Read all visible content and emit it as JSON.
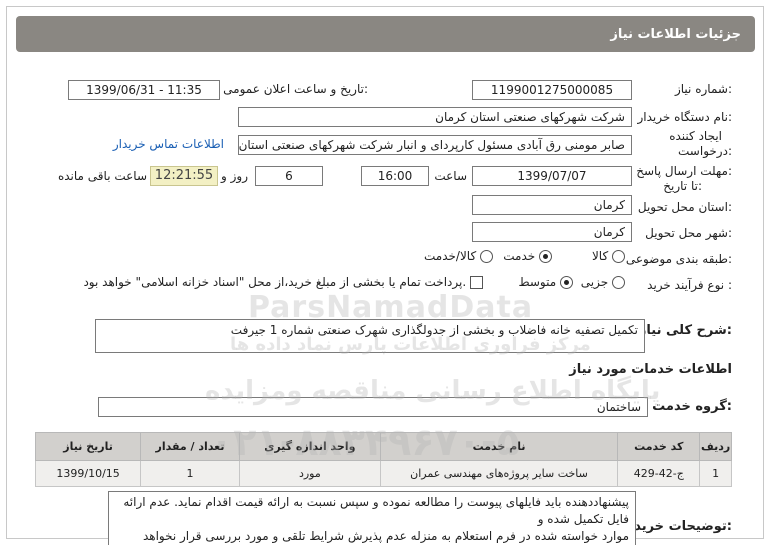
{
  "header": {
    "title": "جزئیات اطلاعات نیاز"
  },
  "fields": {
    "need_number_label": "شماره نیاز:",
    "need_number": "1199001275000085",
    "announce_label": "تاریخ و ساعت اعلان عمومی:",
    "announce_value": "1399/06/31 - 11:35",
    "buyer_label": "نام دستگاه خریدار:",
    "buyer_value": "شرکت شهرکهای صنعتی استان کرمان",
    "creator_label_1": "ایجاد کننده",
    "creator_label_2": "درخواست:",
    "creator_value": "صابر مومنی رق آبادی مسئول کارپردای و انبار شرکت شهرکهای صنعتی استان کرمان",
    "contact_link": "اطلاعات تماس خریدار",
    "deadline_label_1": "مهلت ارسال پاسخ:",
    "deadline_label_2": "تا تاریخ:",
    "deadline_date": "1399/07/07",
    "time_label": "ساعت",
    "deadline_time": "16:00",
    "days_value": "6",
    "days_label": "روز و",
    "remaining_time": "12:21:55",
    "remaining_label": "ساعت باقی مانده",
    "province_label": "استان محل تحویل:",
    "province_value": "کرمان",
    "city_label": "شهر محل تحویل:",
    "city_value": "کرمان",
    "category_label": "طبقه بندی موضوعی:",
    "category_options": [
      "کالا",
      "خدمت",
      "کالا/خدمت"
    ],
    "category_selected": "خدمت",
    "process_label": "نوع فرآیند خرید :",
    "process_options": [
      "جزیی",
      "متوسط"
    ],
    "process_selected": "متوسط",
    "payment_note": "پرداخت تمام یا بخشی از مبلغ خرید،از محل \"اسناد خزانه اسلامی\" خواهد بود."
  },
  "summary": {
    "label": "شرح کلی نیاز:",
    "value": "تکمیل تصفیه خانه فاضلاب و بخشی از جدولگذاری شهرک صنعتی شماره 1 جیرفت"
  },
  "services_section": {
    "title": "اطلاعات خدمات مورد نیاز",
    "group_label": "گروه خدمت:",
    "group_value": "ساختمان"
  },
  "table": {
    "headers": [
      "ردیف",
      "کد خدمت",
      "نام خدمت",
      "واحد اندازه گیری",
      "تعداد / مقدار",
      "تاریخ نیاز"
    ],
    "rows": [
      [
        "1",
        "ج-42-429",
        "ساخت سایر پروژه‌های مهندسی عمران",
        "مورد",
        "1",
        "1399/10/15"
      ]
    ]
  },
  "notes": {
    "label": "توضیحات خریدار:",
    "lines": [
      "پیشنهاددهنده باید فایلهای پیوست را مطالعه نموده و سپس نسبت به ارائه قیمت اقدام نماید. عدم ارائه",
      "فایل تکمیل شده و",
      "موارد خواسته شده در فرم استعلام به منزله عدم پذیرش شرایط تلقی و مورد بررسی قرار نخواهد گرفت."
    ]
  },
  "watermark": {
    "line1": "ParsNamadData",
    "line2": "مرکز فراوری اطلاعات پارس نماد داده ها",
    "line3": "پایگاه اطلاع رسانی مناقصه ومزایده",
    "line4": "۰۲۱-۸۸۳۴۹۶۷۰-۵"
  }
}
